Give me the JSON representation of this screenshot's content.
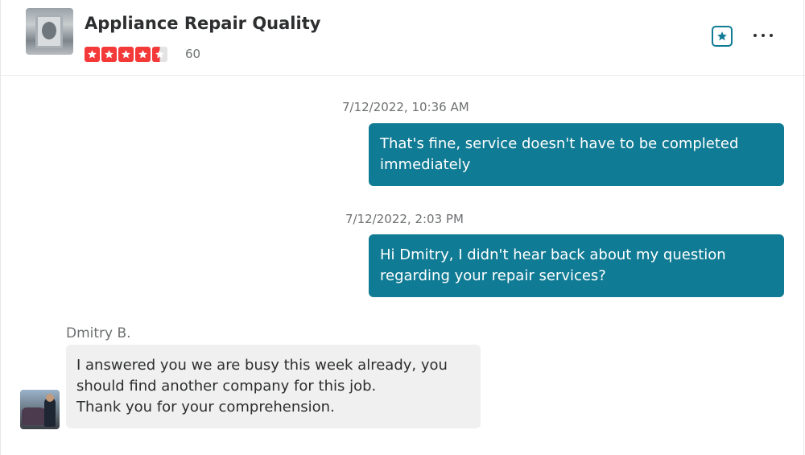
{
  "header": {
    "business_name": "Appliance Repair Quality",
    "rating_stars": 4.5,
    "review_count": "60",
    "star_color": "#f43939",
    "bookmark_icon": "star-icon",
    "more_icon": "more-horizontal-icon"
  },
  "messages": [
    {
      "direction": "outgoing",
      "timestamp": "7/12/2022, 10:36 AM",
      "text": "That's fine, service doesn't have to be completed immediately"
    },
    {
      "direction": "outgoing",
      "timestamp": "7/12/2022, 2:03 PM",
      "text": "Hi Dmitry, I didn't hear back about my question regarding your repair services?"
    },
    {
      "direction": "incoming",
      "sender": "Dmitry B.",
      "text": "I answered you we are busy this week already, you should find another company for this job.\nThank you for your comprehension."
    }
  ],
  "colors": {
    "accent": "#107b94",
    "incoming_bubble": "#f0f0f0",
    "muted_text": "#6e7072"
  }
}
